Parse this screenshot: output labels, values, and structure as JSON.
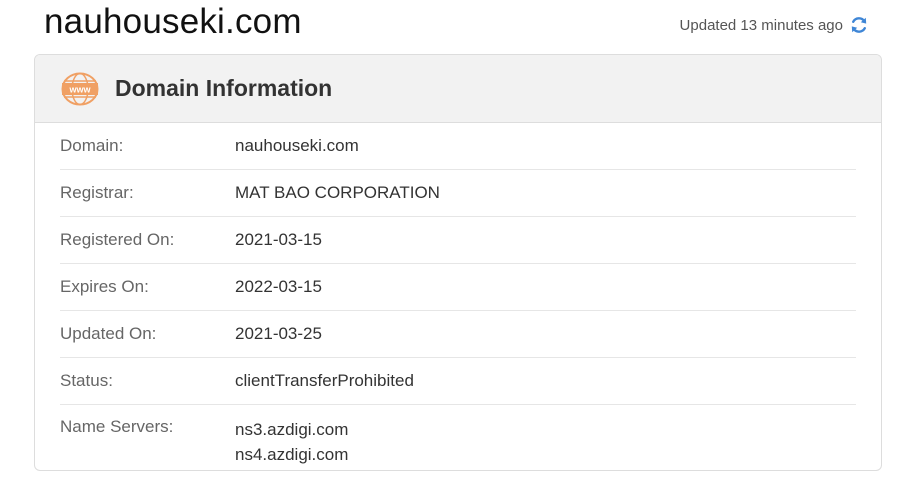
{
  "site": {
    "title": "nauhouseki.com",
    "updated_text": "Updated 13 minutes ago"
  },
  "card": {
    "title": "Domain Information",
    "icon": "www-icon",
    "accent_color": "#f0a064",
    "rows": [
      {
        "label": "Domain:",
        "value": "nauhouseki.com"
      },
      {
        "label": "Registrar:",
        "value": "MAT BAO CORPORATION"
      },
      {
        "label": "Registered On:",
        "value": "2021-03-15"
      },
      {
        "label": "Expires On:",
        "value": "2022-03-15"
      },
      {
        "label": "Updated On:",
        "value": "2021-03-25"
      },
      {
        "label": "Status:",
        "value": "clientTransferProhibited"
      }
    ],
    "name_servers": {
      "label": "Name Servers:",
      "values": [
        "ns3.azdigi.com",
        "ns4.azdigi.com"
      ]
    }
  }
}
